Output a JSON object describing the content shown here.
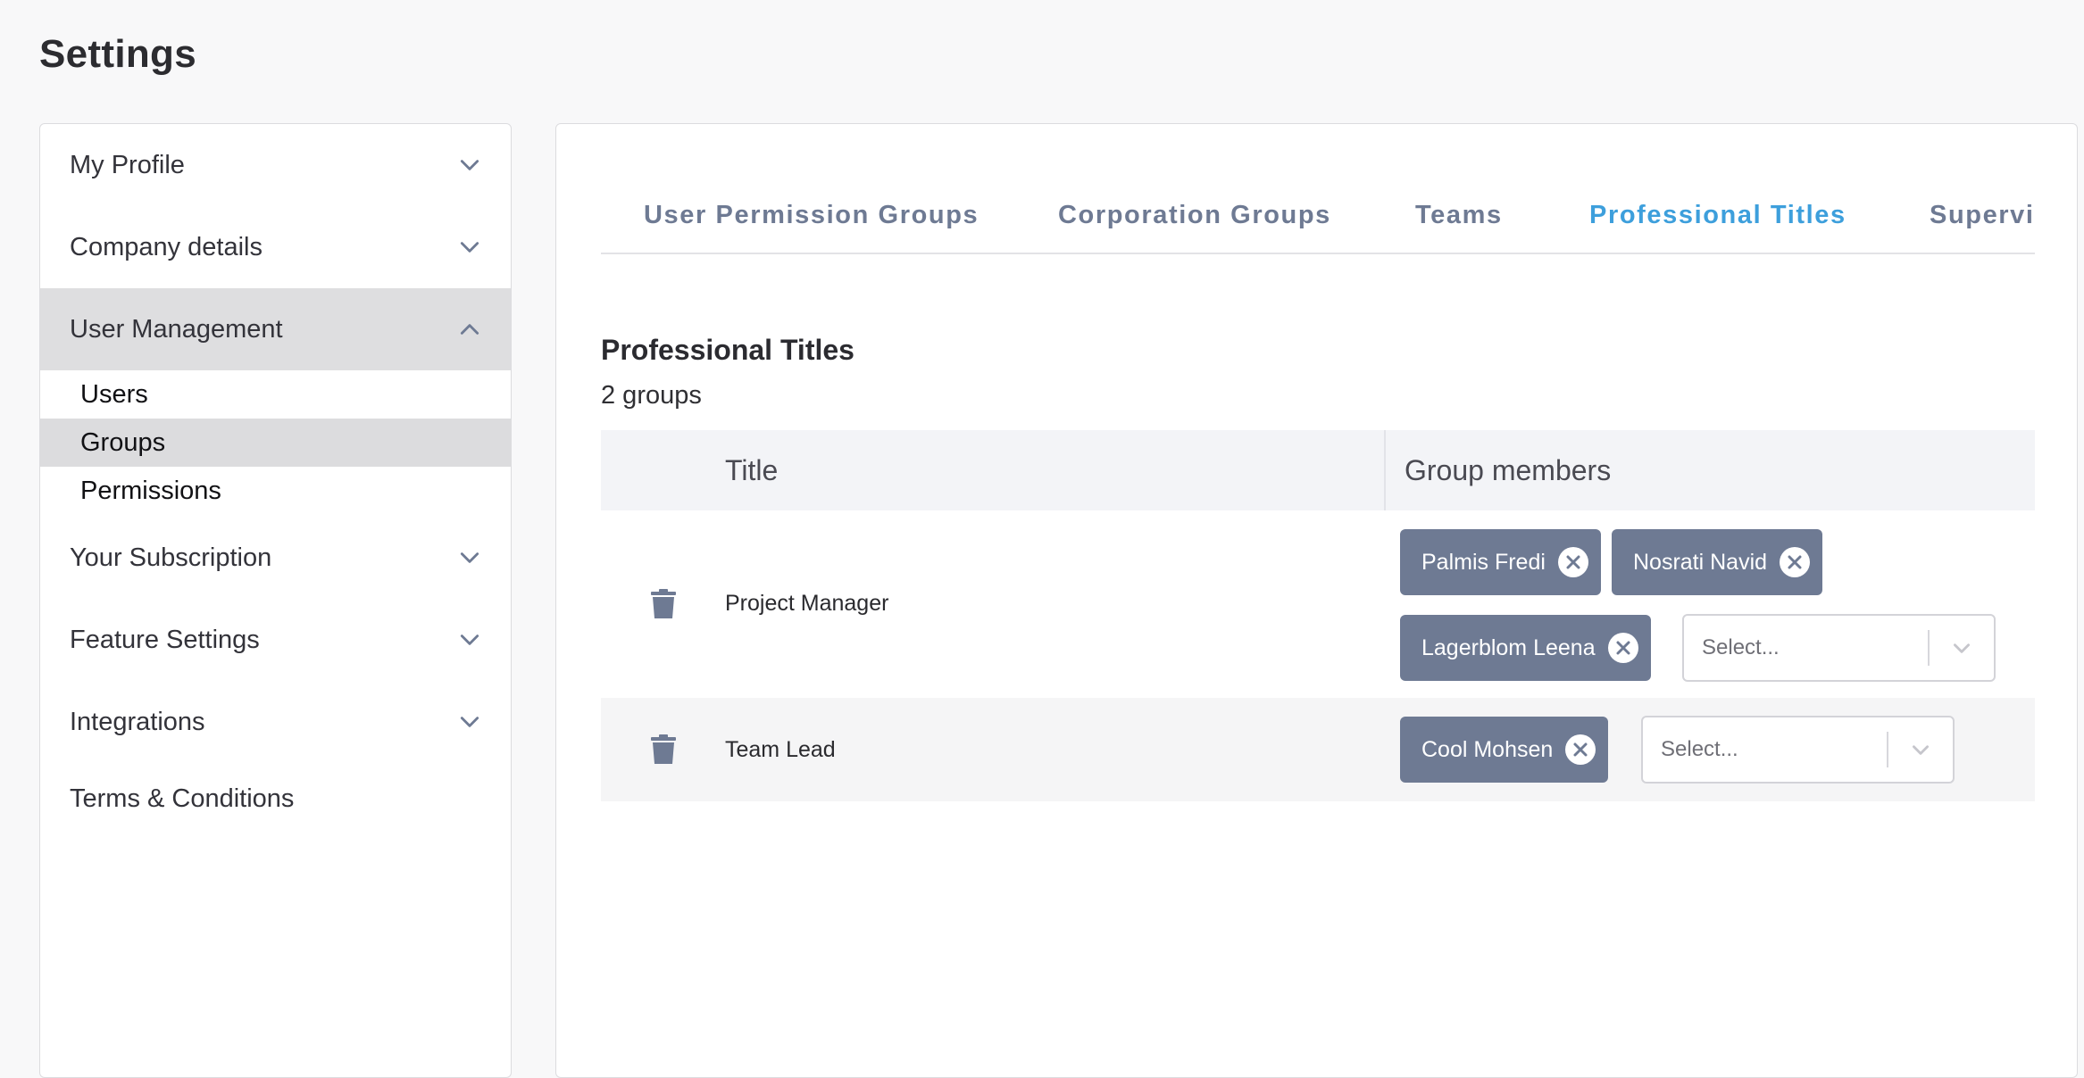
{
  "page": {
    "title": "Settings"
  },
  "sidebar": {
    "items": [
      {
        "label": "My Profile",
        "chevron": "chevron-down-icon"
      },
      {
        "label": "Company details",
        "chevron": "chevron-down-icon"
      },
      {
        "label": "User Management",
        "chevron": "chevron-up-icon",
        "expanded": true
      },
      {
        "label": "Your Subscription",
        "chevron": "chevron-down-icon"
      },
      {
        "label": "Feature Settings",
        "chevron": "chevron-down-icon"
      },
      {
        "label": "Integrations",
        "chevron": "chevron-down-icon"
      },
      {
        "label": "Terms & Conditions"
      }
    ],
    "sub_items": [
      {
        "label": "Users"
      },
      {
        "label": "Groups",
        "active": true
      },
      {
        "label": "Permissions"
      }
    ]
  },
  "tabs": [
    {
      "label": "User Permission Groups"
    },
    {
      "label": "Corporation Groups"
    },
    {
      "label": "Teams"
    },
    {
      "label": "Professional Titles",
      "active": true
    },
    {
      "label": "Supervi"
    }
  ],
  "section": {
    "title": "Professional Titles",
    "count": "2 groups"
  },
  "table": {
    "headers": {
      "title": "Title",
      "members": "Group members"
    },
    "rows": [
      {
        "title": "Project Manager",
        "members": [
          "Palmis Fredi",
          "Nosrati Navid",
          "Lagerblom Leena"
        ],
        "select_placeholder": "Select..."
      },
      {
        "title": "Team Lead",
        "members": [
          "Cool Mohsen"
        ],
        "select_placeholder": "Select..."
      }
    ]
  },
  "colors": {
    "accent": "#3d9fdc",
    "chip": "#6e7a93",
    "tab_inactive": "#6e7a93",
    "sidebar_active": "#dedee0"
  }
}
